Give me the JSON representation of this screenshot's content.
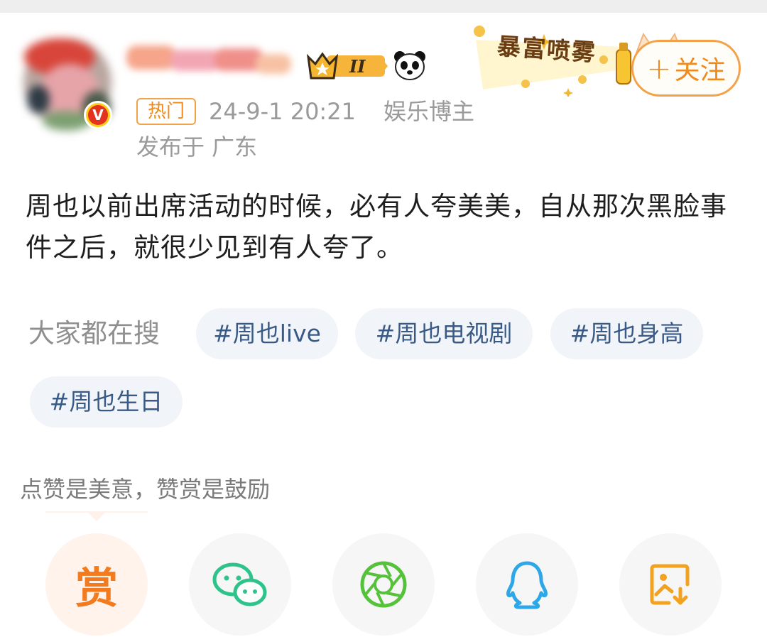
{
  "post": {
    "hot_tag": "热门",
    "time": "24-9-1 20:21",
    "role": "娱乐博主",
    "location": "发布于 广东",
    "follow_label": "关注",
    "follow_plus": "+",
    "banner_text": "暴富喷雾",
    "verified_mark": "V",
    "content": "周也以前出席活动的时候，必有人夸美美，自从那次黑脸事件之后，就很少见到有人夸了。"
  },
  "search": {
    "label": "大家都在搜",
    "tags": [
      "#周也live",
      "#周也电视剧",
      "#周也身高",
      "#周也生日"
    ]
  },
  "share": {
    "hint": "点赞是美意，赞赏是鼓励",
    "reward_label": "赏",
    "buttons": [
      "reward",
      "wechat-icon",
      "moments-icon",
      "qq-icon",
      "save-image-icon"
    ]
  },
  "colors": {
    "accent_orange": "#f08a1c",
    "tag_text": "#3a5a86",
    "chip_bg": "#f1f4f8",
    "wechat_green": "#2dc38a",
    "moments_green": "#56c23c",
    "qq_blue": "#2ea7e8"
  }
}
